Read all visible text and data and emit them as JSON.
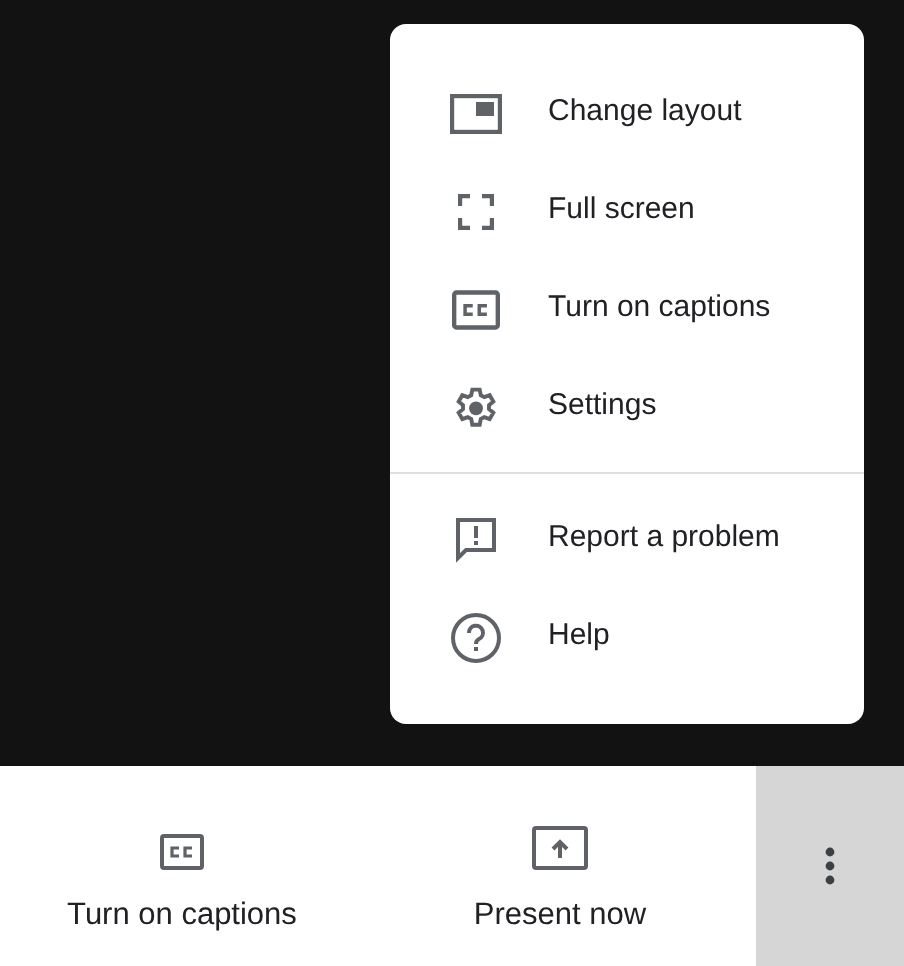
{
  "menu": {
    "sections": [
      [
        {
          "label": "Change layout"
        },
        {
          "label": "Full screen"
        },
        {
          "label": "Turn on captions"
        },
        {
          "label": "Settings"
        }
      ],
      [
        {
          "label": "Report a problem"
        },
        {
          "label": "Help"
        }
      ]
    ]
  },
  "toolbar": {
    "buttons": [
      {
        "label": "Turn on captions"
      },
      {
        "label": "Present now"
      }
    ],
    "more_button": {
      "expanded": true
    }
  }
}
